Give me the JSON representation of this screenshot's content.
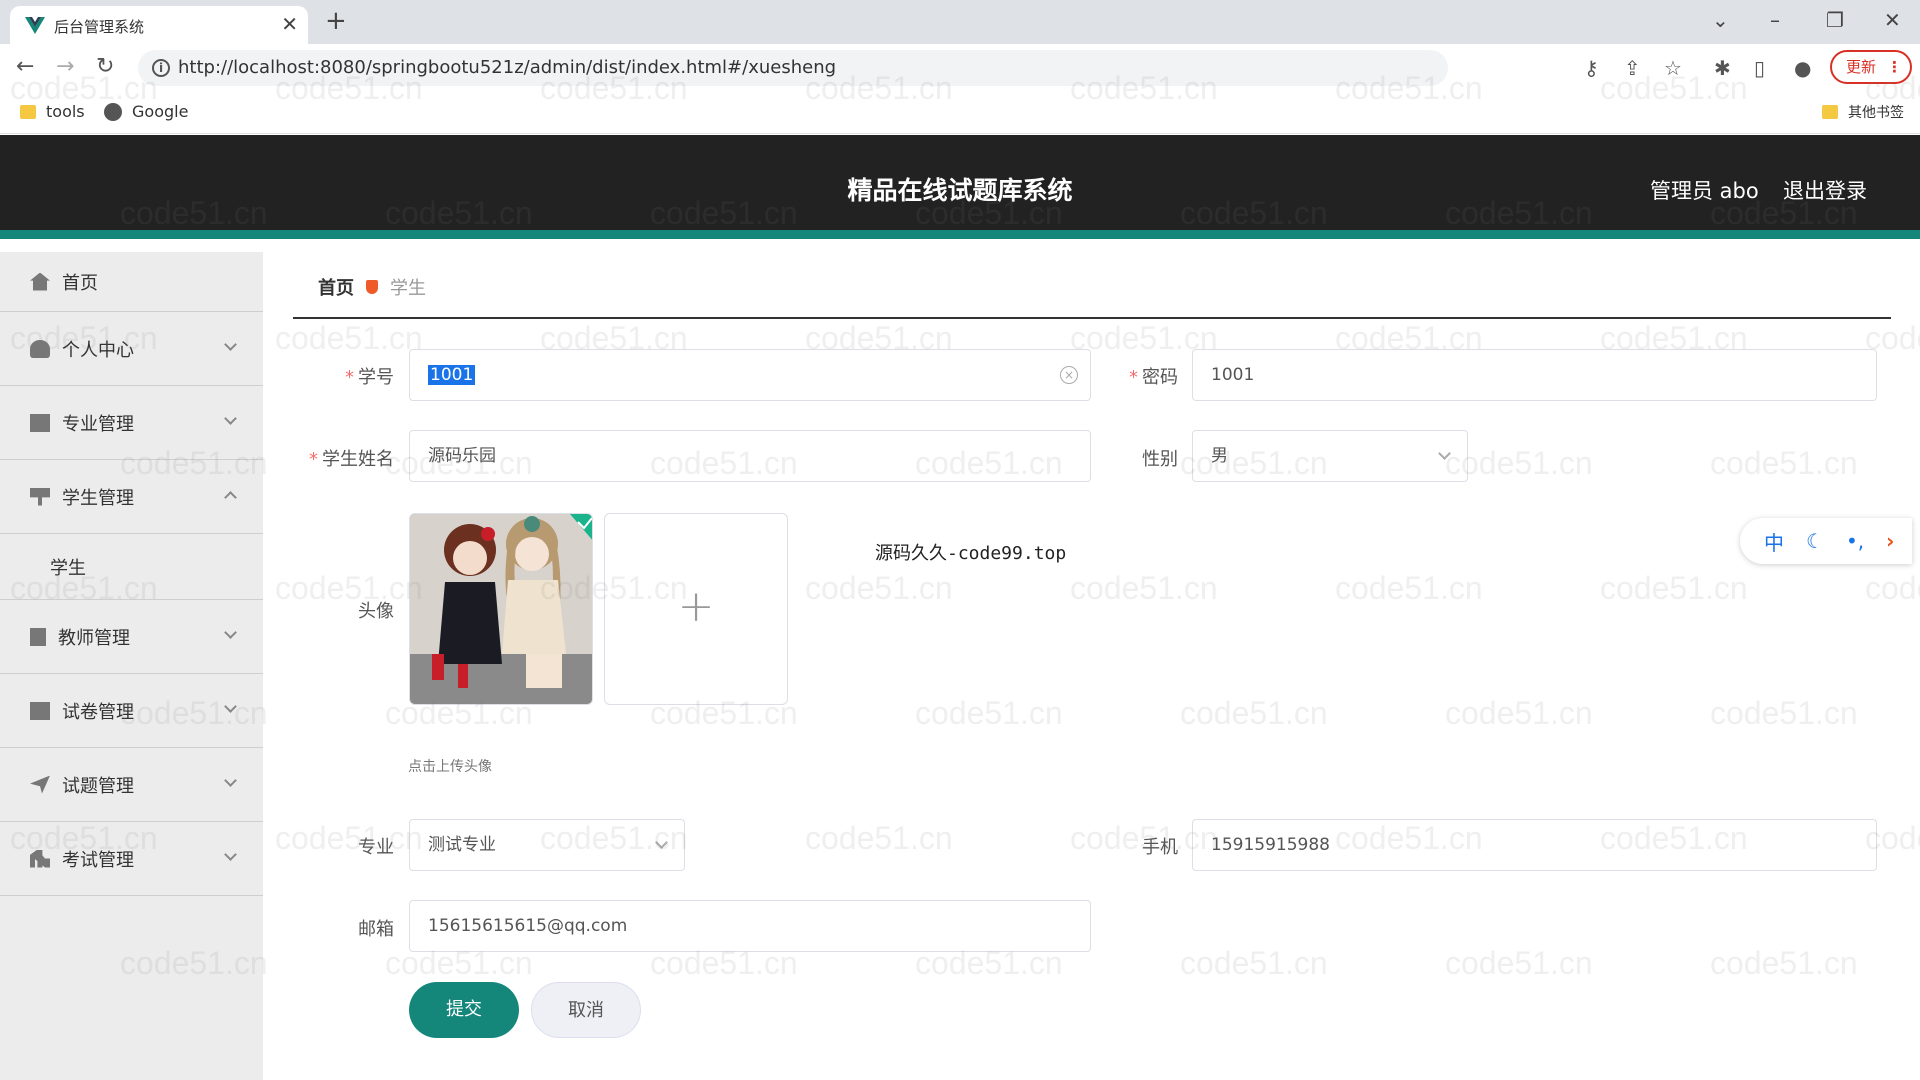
{
  "browser": {
    "tab_title": "后台管理系统",
    "tab_close": "✕",
    "new_tab": "+",
    "url": "http://localhost:8080/springbootu521z/admin/dist/index.html#/xuesheng",
    "update_label": "更新",
    "bookmarks": [
      "tools",
      "Google"
    ],
    "other_bookmarks": "其他书签"
  },
  "header": {
    "title": "精品在线试题库系统",
    "admin": "管理员 abo",
    "logout": "退出登录"
  },
  "sidebar": {
    "items": [
      {
        "label": "首页"
      },
      {
        "label": "个人中心"
      },
      {
        "label": "专业管理"
      },
      {
        "label": "学生管理"
      },
      {
        "label": "学生"
      },
      {
        "label": "教师管理"
      },
      {
        "label": "试卷管理"
      },
      {
        "label": "试题管理"
      },
      {
        "label": "考试管理"
      }
    ]
  },
  "breadcrumb": {
    "home": "首页",
    "current": "学生"
  },
  "form": {
    "student_no": {
      "label": "学号",
      "value": "1001"
    },
    "password": {
      "label": "密码",
      "value": "1001"
    },
    "student_name": {
      "label": "学生姓名",
      "value": "源码乐园"
    },
    "gender": {
      "label": "性别",
      "value": "男"
    },
    "avatar": {
      "label": "头像",
      "hint": "点击上传头像"
    },
    "major": {
      "label": "专业",
      "value": "测试专业"
    },
    "phone": {
      "label": "手机",
      "value": "15915915988"
    },
    "email": {
      "label": "邮箱",
      "value": "15615615615@qq.com"
    },
    "submit": "提交",
    "cancel": "取消"
  },
  "note": "源码久久-code99.top",
  "watermark": "code51.cn",
  "ime": {
    "lang": "中"
  },
  "colors": {
    "accent": "#15877a",
    "header_bg": "#222222",
    "required": "#f56c6c",
    "breadcrumb_marker": "#f05a28"
  }
}
